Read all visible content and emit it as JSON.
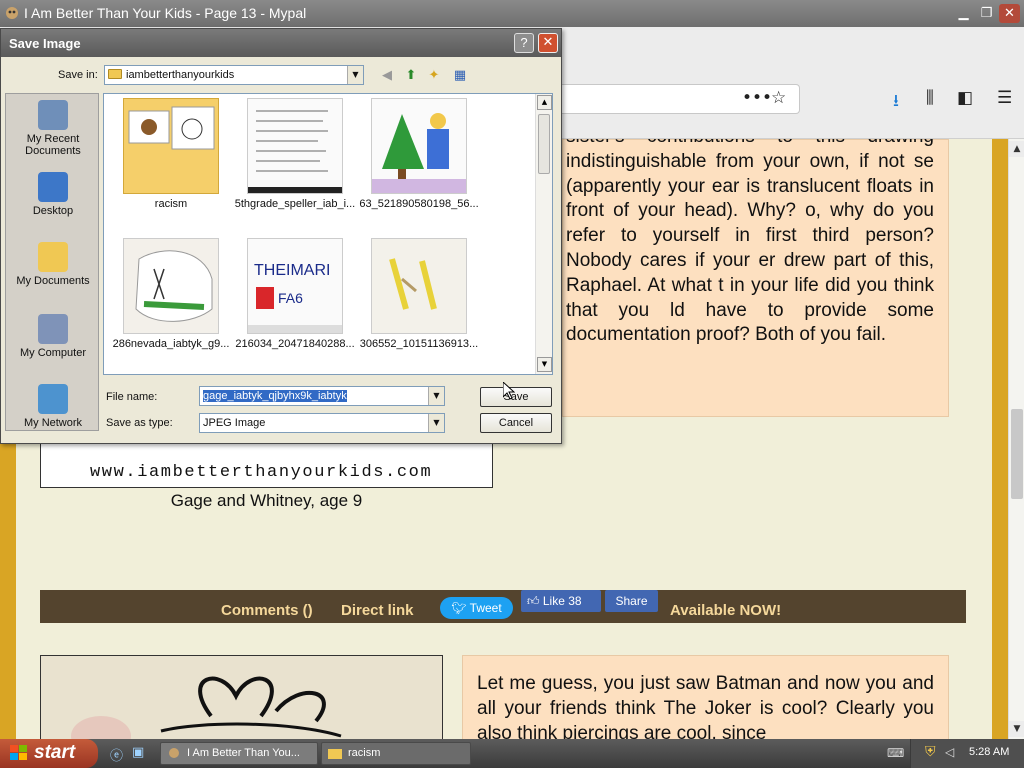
{
  "browser": {
    "title": "I Am Better Than Your Kids - Page 13 - Mypal",
    "toolbar_icons": [
      "more-icon",
      "bookmark-star-icon",
      "download-icon",
      "library-icon",
      "sidebar-icon",
      "menu-icon"
    ]
  },
  "page": {
    "caption_text": "sister's contributions to this drawing indistinguishable from your own, if not se (apparently your ear is translucent floats in front of your head). Why? o, why do you refer to yourself in first third person? Nobody cares if your er drew part of this, Raphael. At what t in your life did you think that you ld have to provide some documentation proof? Both of you fail.",
    "watermark": "www.iambetterthanyourkids.com",
    "image_caption": "Gage and Whitney, age 9",
    "comments_link": "Comments ()",
    "direct_link": "Direct link",
    "tweet": "Tweet",
    "like": "Like 38",
    "share": "Share",
    "available": "Available NOW!",
    "caption_text2": "Let me guess, you just saw Batman and now you and all your friends think The Joker is cool? Clearly you also think piercings are cool, since"
  },
  "dialog": {
    "title": "Save Image",
    "help": "?",
    "close": "✕",
    "save_in_label": "Save in:",
    "save_in_value": "iambetterthanyourkids",
    "places": [
      "My Recent Documents",
      "Desktop",
      "My Documents",
      "My Computer",
      "My Network"
    ],
    "files": [
      {
        "name": "racism"
      },
      {
        "name": "5thgrade_speller_iab_i..."
      },
      {
        "name": "63_521890580198_56..."
      },
      {
        "name": "286nevada_iabtyk_g9..."
      },
      {
        "name": "216034_20471840288..."
      },
      {
        "name": "306552_10151136913..."
      }
    ],
    "file_name_label": "File name:",
    "file_name_value": "gage_iabtyk_qjbyhx9k_iabtyk",
    "save_as_type_label": "Save as type:",
    "save_as_type_value": "JPEG Image",
    "save_button": "Save",
    "cancel_button": "Cancel"
  },
  "taskbar": {
    "start": "start",
    "tasks": [
      "I Am Better Than You...",
      "racism"
    ],
    "clock": "5:28 AM"
  },
  "colors": {
    "caption_bg": "#fde0c0",
    "comments_bar": "#54442e",
    "link_color": "#f5d89b",
    "page_bg": "#f1efd9",
    "border_gold": "#d9a524"
  }
}
